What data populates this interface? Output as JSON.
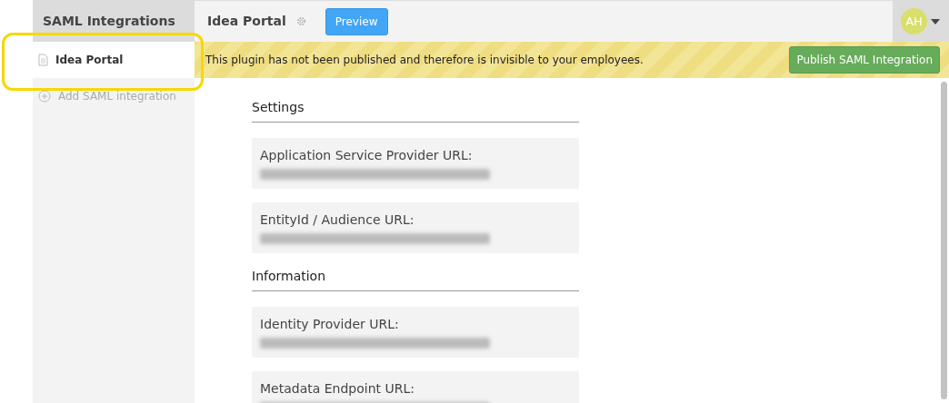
{
  "sidebar": {
    "title": "SAML Integrations",
    "items": [
      {
        "kind": "page",
        "label": "Idea Portal",
        "selected": true,
        "highlighted": true
      },
      {
        "kind": "add",
        "label": "Add SAML integration",
        "selected": false,
        "highlighted": false
      }
    ]
  },
  "header": {
    "title": "Idea Portal",
    "preview_button": "Preview",
    "avatar": "AH"
  },
  "banner": {
    "message": "This plugin has not been published and therefore is invisible to your employees.",
    "button": "Publish SAML Integration"
  },
  "sections": [
    {
      "title": "Settings",
      "fields": [
        {
          "label": "Application Service Provider URL:"
        },
        {
          "label": "EntityId / Audience URL:"
        }
      ]
    },
    {
      "title": "Information",
      "fields": [
        {
          "label": "Identity Provider URL:"
        },
        {
          "label": "Metadata Endpoint URL:"
        }
      ]
    }
  ]
}
